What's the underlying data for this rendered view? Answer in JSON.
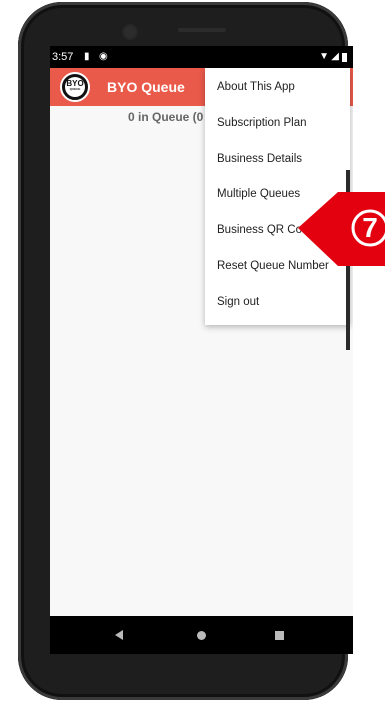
{
  "status_bar": {
    "time": "3:57"
  },
  "app_bar": {
    "logo_text": "BYO",
    "logo_subtext": "QUEUE",
    "title": "BYO Queue"
  },
  "main": {
    "queue_count": "0 in Queue (0"
  },
  "menu": {
    "items": [
      {
        "label": "About This App"
      },
      {
        "label": "Subscription Plan"
      },
      {
        "label": "Business Details"
      },
      {
        "label": "Multiple Queues"
      },
      {
        "label": "Business QR Code"
      },
      {
        "label": "Reset Queue Number"
      },
      {
        "label": "Sign out"
      }
    ]
  },
  "callout": {
    "number": "7",
    "color": "#e3000f"
  },
  "colors": {
    "app_bar": "#ea5a4a",
    "screen_bg": "#f8f8f8",
    "phone_frame": "#1e1e1e"
  },
  "icons": {
    "status": [
      "sd-card-icon",
      "sync-icon",
      "wifi-icon",
      "signal-icon",
      "battery-icon"
    ],
    "nav": [
      "back-icon",
      "home-icon",
      "recents-icon"
    ]
  }
}
